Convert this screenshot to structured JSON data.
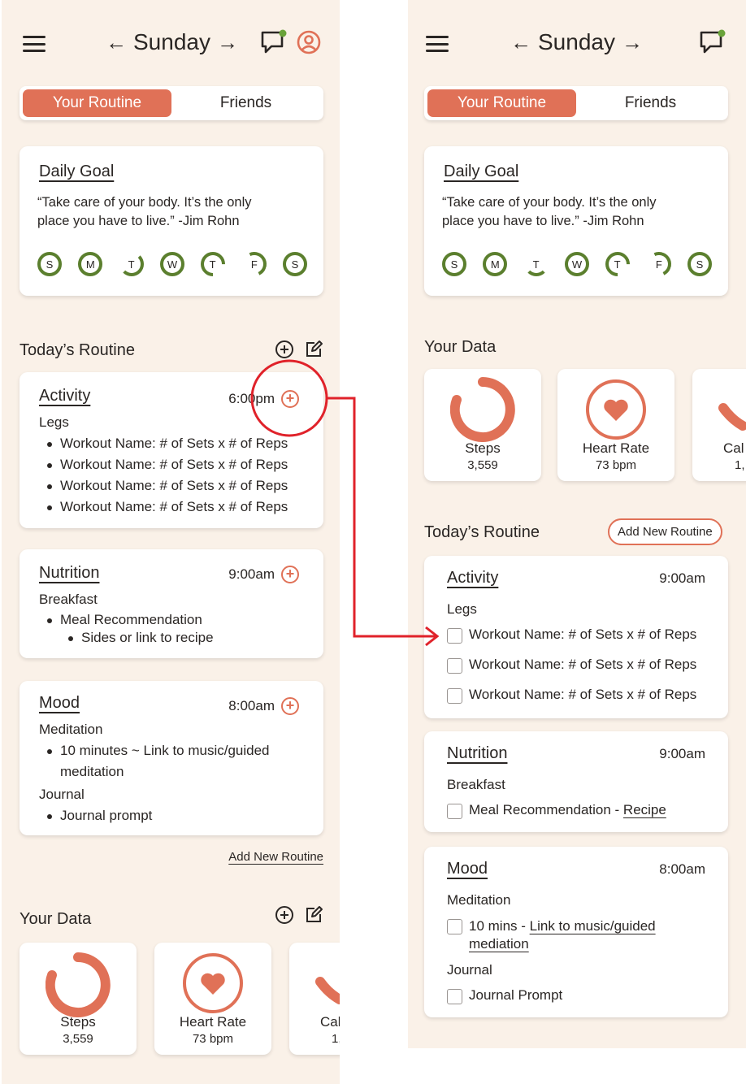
{
  "colors": {
    "accent": "#e07157",
    "ring_green": "#5b7f2e",
    "background": "#faf1e8",
    "annotation_red": "#e0222a"
  },
  "left": {
    "header": {
      "day": "Sunday",
      "icons": [
        "menu-icon",
        "arrow-left-icon",
        "arrow-right-icon",
        "chat-icon",
        "profile-icon"
      ]
    },
    "tabs": [
      {
        "label": "Your Routine",
        "active": true
      },
      {
        "label": "Friends",
        "active": false
      }
    ],
    "daily_goal": {
      "title": "Daily Goal",
      "quote_line1": "“Take care of your body. It’s the only",
      "quote_line2": "place you have to live.” -Jim Rohn",
      "days": [
        "S",
        "M",
        "T",
        "W",
        "T",
        "F",
        "S"
      ]
    },
    "routine_title": "Today’s Routine",
    "activity": {
      "title": "Activity",
      "time": "6:00pm",
      "subtitle": "Legs",
      "items": [
        "Workout Name: # of Sets x # of Reps",
        "Workout Name: # of Sets x # of Reps",
        "Workout Name: # of Sets x # of Reps",
        "Workout Name: # of Sets x # of Reps"
      ]
    },
    "nutrition": {
      "title": "Nutrition",
      "time": "9:00am",
      "subtitle": "Breakfast",
      "item": "Meal Recommendation",
      "nested_item": "Sides or link to recipe"
    },
    "mood": {
      "title": "Mood",
      "time": "8:00am",
      "subtitle": "Meditation",
      "item_line1": "10 minutes ~ Link to music/guided",
      "item_line2": "meditation",
      "journal_title": "Journal",
      "journal_item": "Journal prompt"
    },
    "add_new_routine": "Add New Routine",
    "your_data": {
      "title": "Your Data",
      "cards": [
        {
          "label": "Steps",
          "value": "3,559"
        },
        {
          "label": "Heart Rate",
          "value": "73 bpm"
        },
        {
          "label": "Cal",
          "value": "1,"
        }
      ]
    }
  },
  "right": {
    "header": {
      "day": "Sunday"
    },
    "tabs": [
      {
        "label": "Your Routine",
        "active": true
      },
      {
        "label": "Friends",
        "active": false
      }
    ],
    "daily_goal": {
      "title": "Daily Goal",
      "quote_line1": "“Take care of your body. It’s the only",
      "quote_line2": "place you have to live.” -Jim Rohn",
      "days": [
        "S",
        "M",
        "T",
        "W",
        "T",
        "F",
        "S"
      ]
    },
    "your_data": {
      "title": "Your Data",
      "cards": [
        {
          "label": "Steps",
          "value": "3,559"
        },
        {
          "label": "Heart Rate",
          "value": "73 bpm"
        },
        {
          "label": "Cal",
          "value": "1,"
        }
      ]
    },
    "routine_title": "Today’s Routine",
    "add_new_routine": "Add New Routine",
    "activity": {
      "title": "Activity",
      "time": "9:00am",
      "subtitle": "Legs",
      "items": [
        "Workout Name: # of Sets x # of Reps",
        "Workout Name: # of Sets x # of Reps",
        "Workout Name: # of Sets x # of Reps"
      ]
    },
    "nutrition": {
      "title": "Nutrition",
      "time": "9:00am",
      "subtitle": "Breakfast",
      "item_text": "Meal Recommendation - ",
      "item_link": "Recipe"
    },
    "mood": {
      "title": "Mood",
      "time": "8:00am",
      "subtitle": "Meditation",
      "item_text": "10 mins - ",
      "item_link_line1": "Link to music/guided",
      "item_link_line2": "mediation",
      "journal_title": "Journal",
      "journal_item": "Journal Prompt"
    }
  }
}
